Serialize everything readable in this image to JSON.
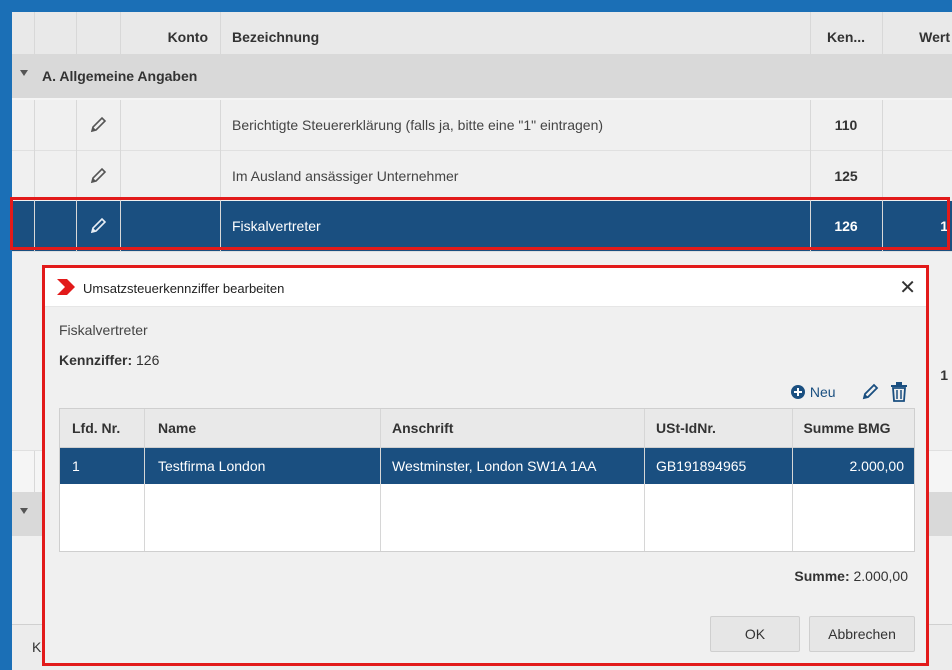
{
  "grid": {
    "headers": {
      "konto": "Konto",
      "bezeichnung": "Bezeichnung",
      "kennziffer": "Ken...",
      "wert": "Wert"
    },
    "group_a": "A. Allgemeine Angaben",
    "rows": [
      {
        "bezeichnung": "Berichtigte Steuererklärung (falls ja, bitte eine \"1\" eintragen)",
        "kennziffer": "110",
        "wert": ""
      },
      {
        "bezeichnung": "Im Ausland ansässiger Unternehmer",
        "kennziffer": "125",
        "wert": ""
      },
      {
        "bezeichnung": "Fiskalvertreter",
        "kennziffer": "126",
        "wert": "1"
      }
    ],
    "hidden_value_1": "1",
    "footer_label": "K",
    "colors": {
      "selected_row": "#1a4f80",
      "frame": "#1b6fb6",
      "highlight": "#e21a1a"
    }
  },
  "dialog": {
    "title": "Umsatzsteuerkennziffer bearbeiten",
    "subtitle": "Fiskalvertreter",
    "kennziffer_label": "Kennziffer:",
    "kennziffer_value": "126",
    "toolbar": {
      "new_label": "Neu",
      "new_icon": "plus-circle-icon",
      "edit_icon": "pencil-icon",
      "delete_icon": "trash-icon"
    },
    "table": {
      "headers": [
        "Lfd. Nr.",
        "Name",
        "Anschrift",
        "USt-IdNr.",
        "Summe BMG"
      ],
      "rows": [
        [
          "1",
          "Testfirma London",
          "Westminster, London SW1A 1AA",
          "GB191894965",
          "2.000,00"
        ]
      ]
    },
    "summe_label": "Summe:",
    "summe_value": "2.000,00",
    "ok_label": "OK",
    "cancel_label": "Abbrechen",
    "close_icon": "close-icon"
  }
}
